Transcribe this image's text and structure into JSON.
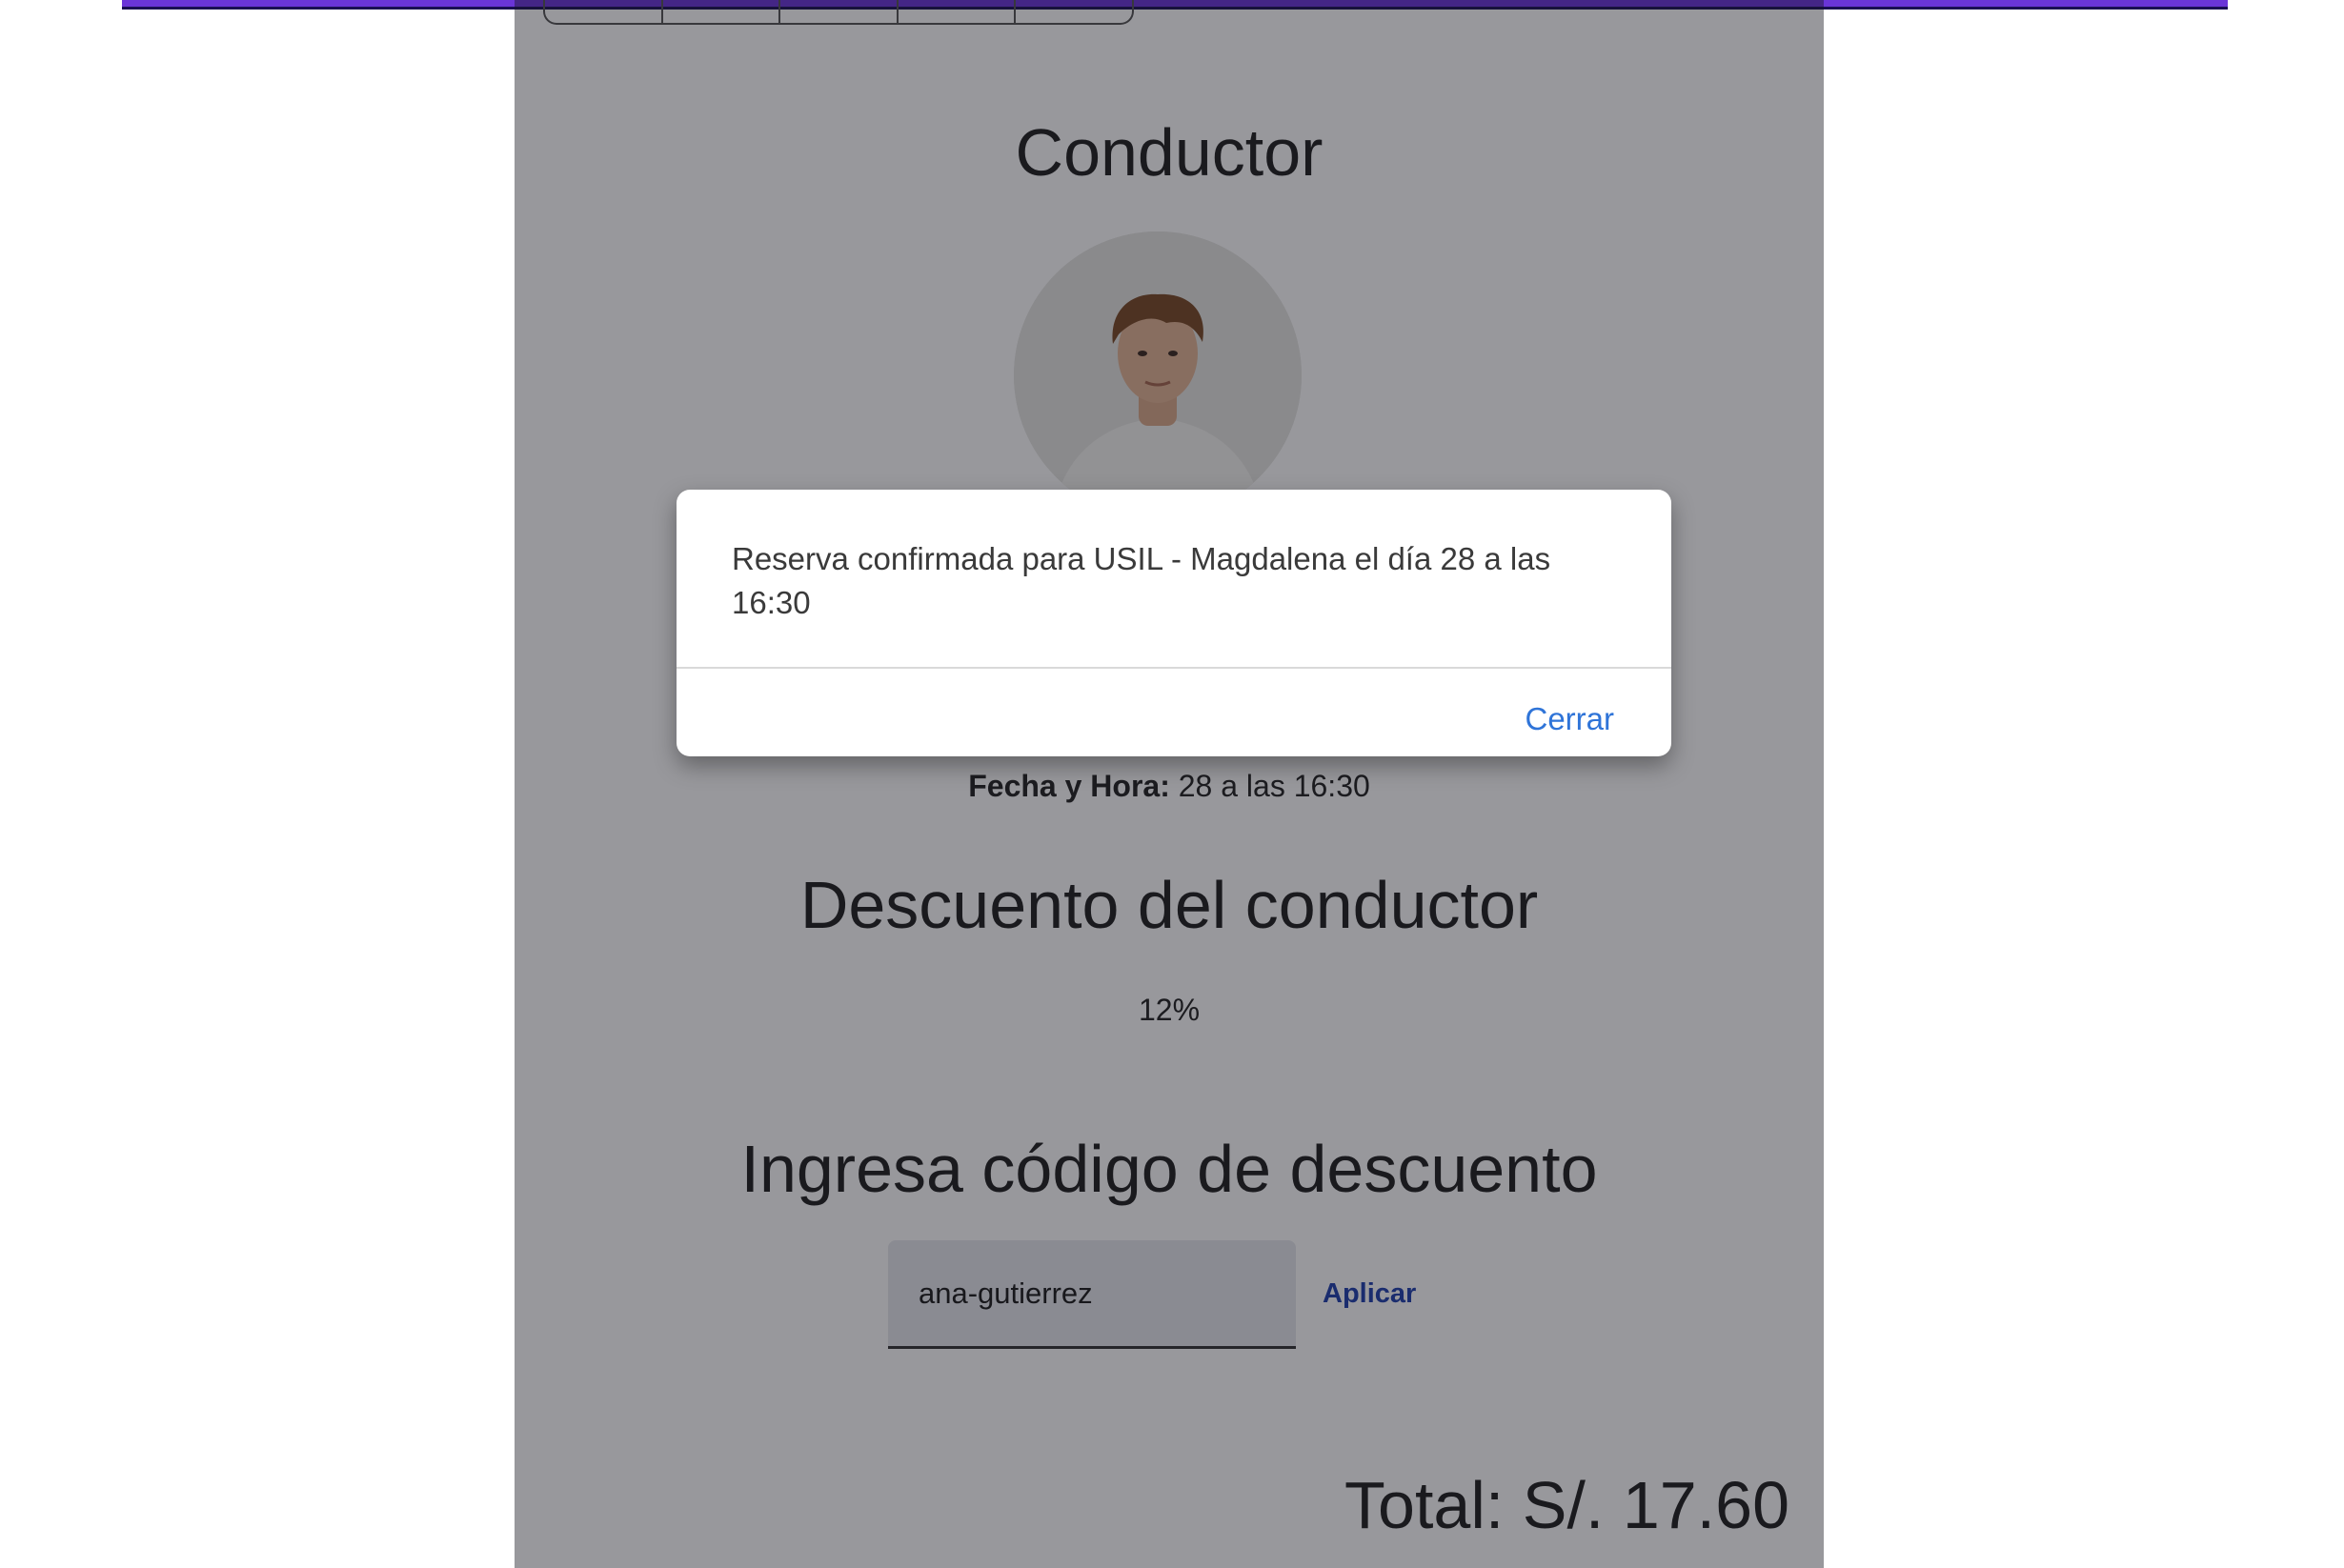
{
  "colors": {
    "top_bar": "#6a35d8",
    "accent_link": "#1f3fae",
    "dialog_button": "#2f74d8",
    "overlay": "rgba(20,20,30,0.44)"
  },
  "driver_section": {
    "title": "Conductor",
    "avatar": "driver-photo",
    "datetime_label": "Fecha y Hora:",
    "datetime_value": "28 a las 16:30"
  },
  "discount_section": {
    "title": "Descuento del conductor",
    "value": "12%"
  },
  "code_section": {
    "title": "Ingresa código de descuento",
    "input_value": "ana-gutierrez",
    "apply_label": "Aplicar"
  },
  "total": {
    "text": "Total: S/. 17.60"
  },
  "dialog": {
    "message": "Reserva confirmada para USIL - Magdalena el día 28 a las 16:30",
    "close_label": "Cerrar"
  }
}
